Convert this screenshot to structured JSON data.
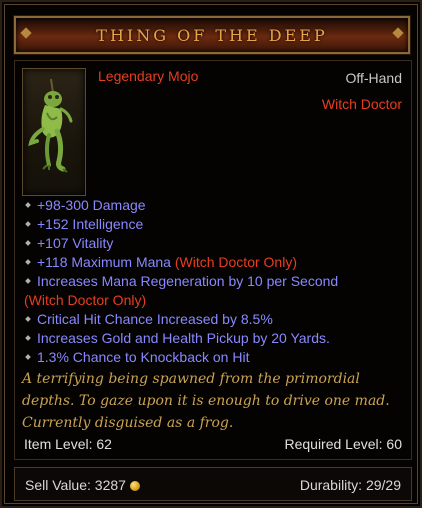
{
  "item": {
    "name": "THING OF THE DEEP",
    "type": "Legendary Mojo",
    "slot": "Off-Hand",
    "class_requirement": "Witch Doctor",
    "icon": "frog-mojo-icon"
  },
  "affixes": [
    {
      "text": "+98-300 Damage"
    },
    {
      "text": "+152 Intelligence"
    },
    {
      "text": "+107 Vitality"
    },
    {
      "text": "+118 Maximum Mana",
      "suffix": "(Witch Doctor Only)"
    },
    {
      "text": "Increases Mana Regeneration by 10 per Second"
    },
    {
      "text": "(Witch Doctor Only)"
    },
    {
      "text": "Critical Hit Chance Increased by 8.5%"
    },
    {
      "text": "Increases Gold and Health Pickup by 20 Yards."
    },
    {
      "text": "1.3% Chance to Knockback on Hit"
    }
  ],
  "flavor": [
    "A terrifying being spawned from the primordial",
    "depths. To gaze upon it is enough to drive one mad.",
    "Currently disguised as a frog."
  ],
  "levels": {
    "item_level": "Item Level: 62",
    "required_level": "Required Level: 60"
  },
  "footer": {
    "sell_label": "Sell Value: 3287",
    "durability_label": "Durability: 29/29"
  },
  "colors": {
    "title": "#e9a24a",
    "legendary": "#e83d1f",
    "affix": "#8888ff",
    "flavor": "#c9a351"
  }
}
